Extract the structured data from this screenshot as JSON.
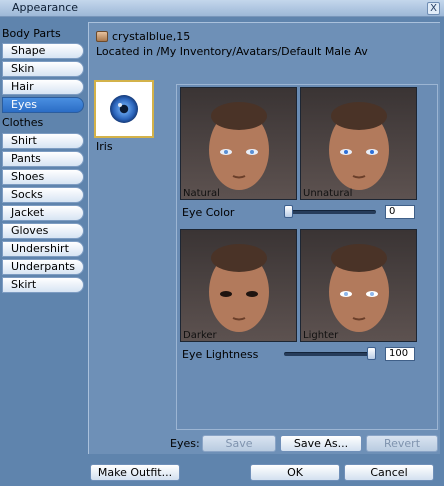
{
  "window": {
    "title": "Appearance",
    "close_glyph": "X"
  },
  "sidebar": {
    "body_parts_label": "Body Parts",
    "body_parts": [
      "Shape",
      "Skin",
      "Hair",
      "Eyes"
    ],
    "clothes_label": "Clothes",
    "clothes": [
      "Shirt",
      "Pants",
      "Shoes",
      "Socks",
      "Jacket",
      "Gloves",
      "Undershirt",
      "Underpants",
      "Skirt"
    ],
    "selected": "Eyes"
  },
  "item": {
    "name": "crystalblue,15",
    "location": "Located in /My Inventory/Avatars/Default Male Av",
    "icon": "bodypart-icon"
  },
  "iris": {
    "label": "Iris",
    "color": "#3a6fc0"
  },
  "params": [
    {
      "name": "Eye Color",
      "left_label": "Natural",
      "right_label": "Unnatural",
      "value": "0",
      "slider_fraction": 0.0
    },
    {
      "name": "Eye Lightness",
      "left_label": "Darker",
      "right_label": "Lighter",
      "value": "100",
      "slider_fraction": 1.0
    }
  ],
  "eyes_actions": {
    "label": "Eyes:",
    "save": "Save",
    "save_as": "Save As...",
    "revert": "Revert"
  },
  "footer": {
    "make_outfit": "Make Outfit...",
    "ok": "OK",
    "cancel": "Cancel"
  }
}
